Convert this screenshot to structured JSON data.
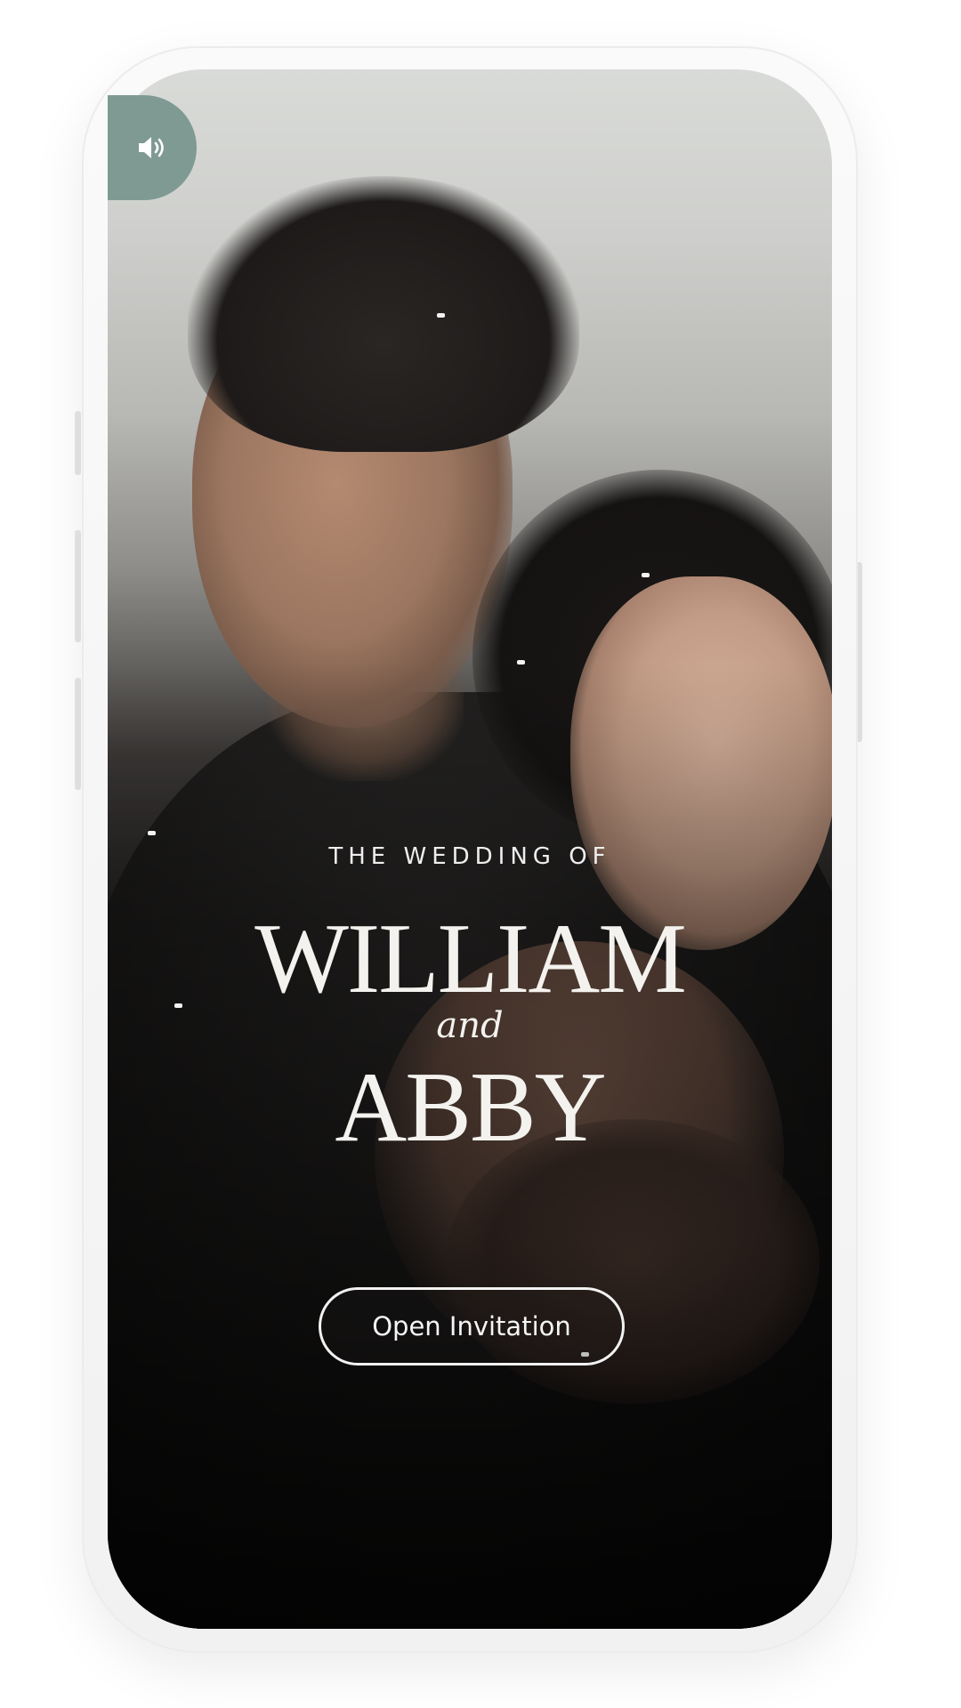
{
  "app": {
    "audio_button": {
      "icon": "speaker-icon",
      "state": "on"
    },
    "pretitle": "THE WEDDING OF",
    "groom_name": "WILLIAM",
    "connector": "and",
    "bride_name": "ABBY",
    "open_button": {
      "label": "Open Invitation"
    }
  },
  "colors": {
    "audio_button_bg": "#7f9a93",
    "text": "#f4f2ee",
    "button_border": "#f2f2f2"
  }
}
